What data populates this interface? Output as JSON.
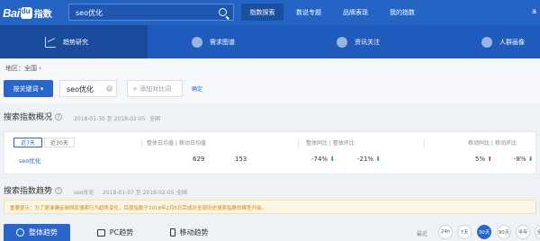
{
  "header": {
    "logo_text": "Bai",
    "logo_suffix": "指数",
    "search_value": "seo优化",
    "nav": [
      {
        "label": "指数探索",
        "active": true
      },
      {
        "label": "数说专题",
        "active": false
      },
      {
        "label": "品牌表现",
        "active": false
      },
      {
        "label": "我的指数",
        "active": false
      }
    ],
    "user_initial": "a"
  },
  "subnav": [
    {
      "label": "趋势研究",
      "icon": "line-chart-icon",
      "active": true
    },
    {
      "label": "需求图谱",
      "icon": "demand-map-icon",
      "active": false
    },
    {
      "label": "资讯关注",
      "icon": "news-icon",
      "active": false
    },
    {
      "label": "人群画像",
      "icon": "user-profile-icon",
      "active": false
    }
  ],
  "filter": {
    "region": "地区：全国 ›",
    "keyword_button": "按关键词 ▾",
    "keyword": "seo优化",
    "add_compare": "+ 添加对比词",
    "confirm": "确定"
  },
  "overview": {
    "title": "搜索指数概况",
    "date_range": "2018-01-30 至 2018-02-05",
    "scope": "全国",
    "period_tabs": [
      "近7天",
      "近30天"
    ],
    "columns": [
      "整体日均值 | 移动日均值",
      "整体同比 | 整体环比",
      "移动同比 | 移动环比"
    ],
    "row": {
      "keyword": "seo优化",
      "overall_avg": "629",
      "mobile_avg": "153",
      "overall_yoy": "-74%",
      "overall_mom": "-21%",
      "mobile_yoy": "5%",
      "mobile_mom": "-8%"
    }
  },
  "trend": {
    "title": "搜索指数趋势",
    "keyword": "seo优化",
    "date_range": "2018-01-07 至 2018-02-05",
    "scope": "全国",
    "notice": "重要提示：为了更准确反映网民搜索行为趋势变化，百度指数于2018年2月5日完成对全部历史搜索指数的模型升级。",
    "tabs": [
      "整体趋势",
      "PC趋势",
      "移动趋势"
    ],
    "range_label": "最近",
    "ranges": [
      "24h",
      "7天",
      "30天",
      "90天",
      "半年",
      "全部"
    ],
    "active_range": "30天"
  },
  "colors": {
    "topbar": "#2364c5",
    "subbar": "#1f5bbd",
    "accent": "#2a66c9",
    "down": "#2ea14d",
    "up": "#e0433a"
  }
}
